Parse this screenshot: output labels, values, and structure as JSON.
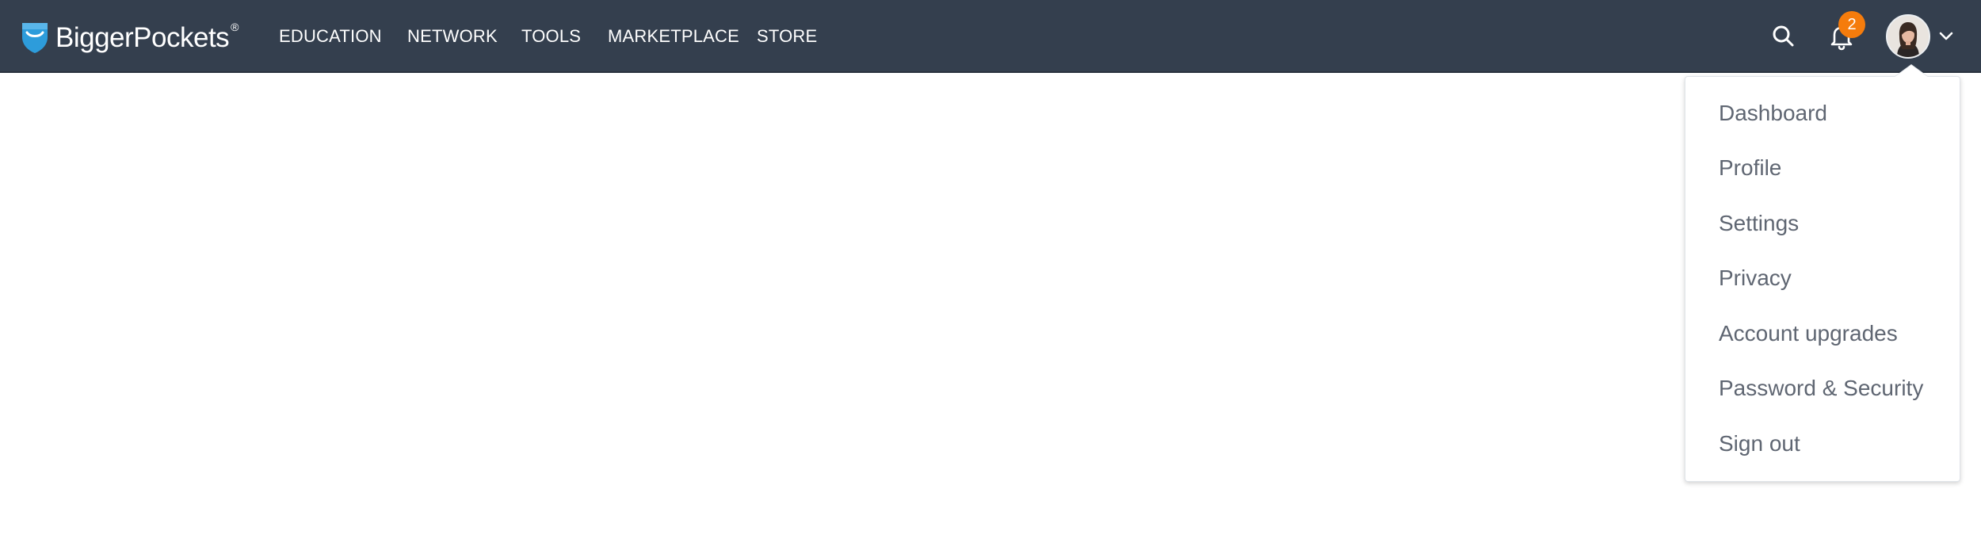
{
  "brand": {
    "name": "BiggerPockets",
    "registered_mark": "®",
    "logo_color": "#2d9cdb"
  },
  "colors": {
    "topbar_bg": "#343f4e",
    "badge_bg": "#f57c0c",
    "menu_text": "#5f6672"
  },
  "nav": {
    "items": [
      {
        "label": "EDUCATION"
      },
      {
        "label": "NETWORK"
      },
      {
        "label": "TOOLS"
      },
      {
        "label": "MARKETPLACE"
      },
      {
        "label": "STORE"
      }
    ]
  },
  "header_actions": {
    "search_icon": "search-icon",
    "notifications_icon": "bell-icon",
    "notification_count": "2",
    "avatar_icon": "user-avatar",
    "menu_toggle_icon": "chevron-down-icon"
  },
  "user_menu": {
    "items": [
      {
        "label": "Dashboard"
      },
      {
        "label": "Profile"
      },
      {
        "label": "Settings"
      },
      {
        "label": "Privacy"
      },
      {
        "label": "Account upgrades"
      },
      {
        "label": "Password & Security"
      },
      {
        "label": "Sign out"
      }
    ]
  }
}
